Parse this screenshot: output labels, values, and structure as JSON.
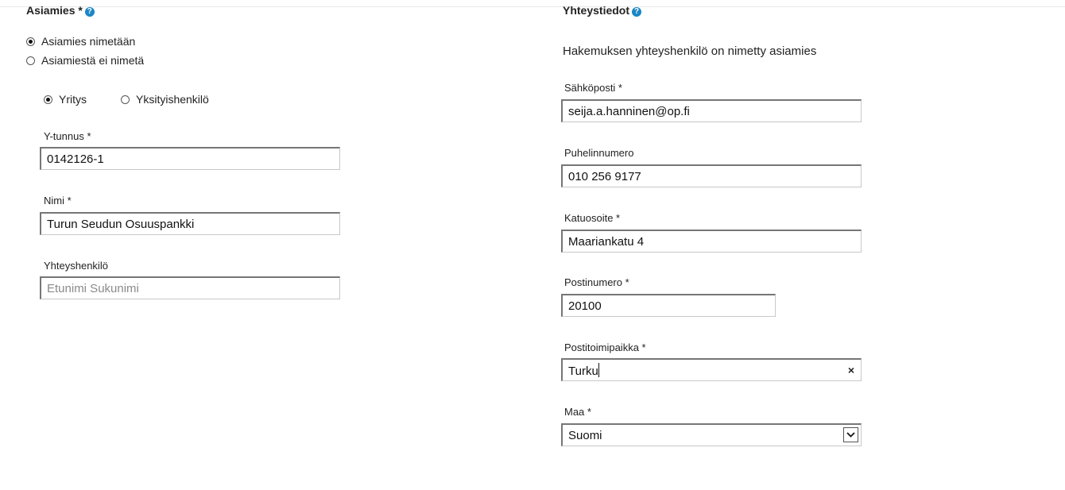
{
  "left": {
    "title": "Asiamies *",
    "radios": [
      {
        "label": "Asiamies nimetään",
        "checked": true
      },
      {
        "label": "Asiamiestä ei nimetä",
        "checked": false
      }
    ],
    "type_radios": [
      {
        "label": "Yritys",
        "checked": true
      },
      {
        "label": "Yksityishenkilö",
        "checked": false
      }
    ],
    "fields": {
      "ytunnus": {
        "label": "Y-tunnus *",
        "value": "0142126-1"
      },
      "nimi": {
        "label": "Nimi *",
        "value": "Turun Seudun Osuuspankki"
      },
      "yhteyshenkilo": {
        "label": "Yhteyshenkilö",
        "value": "",
        "placeholder": "Etunimi Sukunimi"
      }
    }
  },
  "right": {
    "title": "Yhteystiedot",
    "info": "Hakemuksen yhteyshenkilö on nimetty asiamies",
    "fields": {
      "email": {
        "label": "Sähköposti *",
        "value": "seija.a.hanninen@op.fi"
      },
      "phone": {
        "label": "Puhelinnumero",
        "value": "010 256 9177"
      },
      "street": {
        "label": "Katuosoite *",
        "value": "Maariankatu 4"
      },
      "postcode": {
        "label": "Postinumero *",
        "value": "20100"
      },
      "city": {
        "label": "Postitoimipaikka *",
        "value": "Turku",
        "clear_glyph": "×"
      },
      "country": {
        "label": "Maa *",
        "value": "Suomi"
      }
    }
  },
  "icons": {
    "help": "?"
  },
  "colors": {
    "help_icon": "#1a86c6"
  }
}
